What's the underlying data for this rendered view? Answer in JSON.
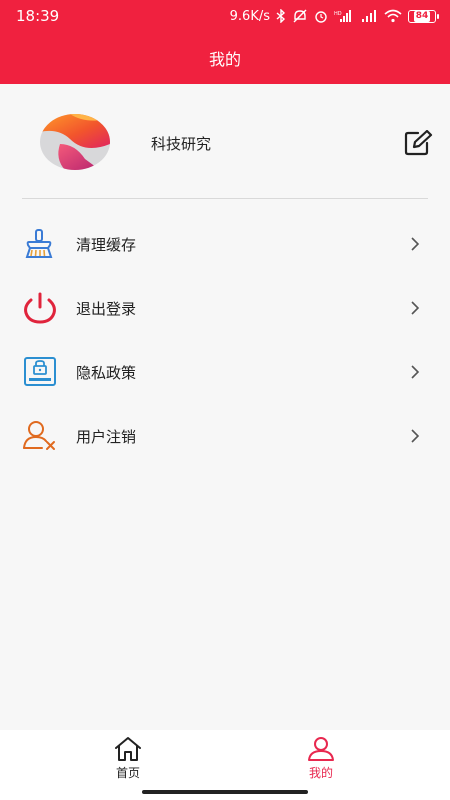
{
  "status_bar": {
    "time": "18:39",
    "network_speed": "9.6K/s",
    "battery": "84"
  },
  "header": {
    "title": "我的"
  },
  "profile": {
    "username": "科技研究"
  },
  "menu": {
    "items": [
      {
        "label": "清理缓存",
        "icon": "broom-icon"
      },
      {
        "label": "退出登录",
        "icon": "power-icon"
      },
      {
        "label": "隐私政策",
        "icon": "privacy-lock-icon"
      },
      {
        "label": "用户注销",
        "icon": "user-remove-icon"
      }
    ]
  },
  "tabbar": {
    "tabs": [
      {
        "label": "首页",
        "icon": "home-icon"
      },
      {
        "label": "我的",
        "icon": "user-icon",
        "active": true
      }
    ]
  },
  "colors": {
    "brand": "#f0213f",
    "active_tab": "#e8284f"
  }
}
